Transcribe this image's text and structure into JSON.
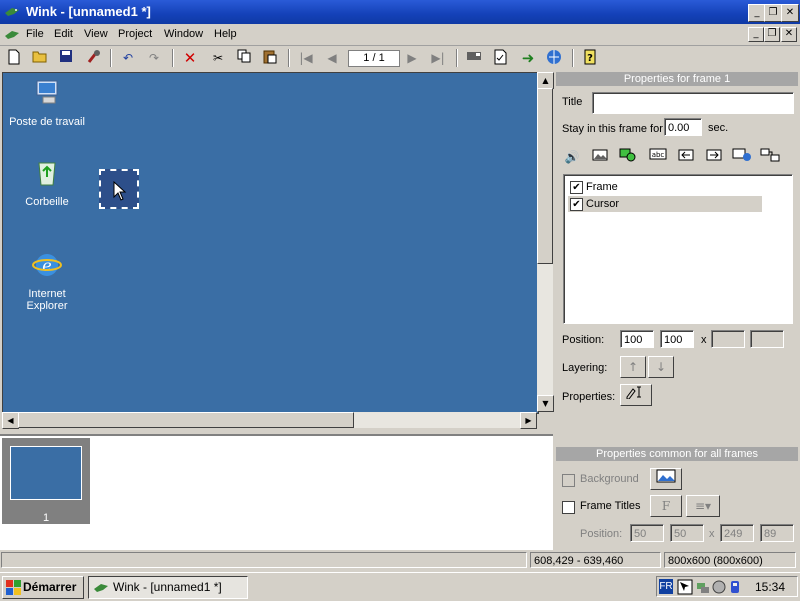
{
  "window": {
    "title": "Wink - [unnamed1 *]",
    "minimize": "_",
    "restore": "❐",
    "close": "✕"
  },
  "menu": [
    "File",
    "Edit",
    "View",
    "Project",
    "Window",
    "Help"
  ],
  "toolbar": {
    "frame_counter": "1 / 1"
  },
  "desktop": {
    "icons": [
      {
        "label": "Poste de travail"
      },
      {
        "label": "Corbeille"
      },
      {
        "label": "Internet\nExplorer"
      }
    ]
  },
  "filmstrip": {
    "frames": [
      {
        "number": "1"
      }
    ]
  },
  "properties_frame": {
    "header": "Properties for frame 1",
    "title_label": "Title",
    "title_value": "",
    "stay_label": "Stay in this frame for",
    "stay_value": "0.00",
    "stay_unit": "sec.",
    "layers": [
      {
        "label": "Frame",
        "checked": true,
        "selected": false
      },
      {
        "label": "Cursor",
        "checked": true,
        "selected": true
      }
    ],
    "position_label": "Position:",
    "position_x": "100",
    "position_y": "100",
    "position_sep": "x",
    "layering_label": "Layering:",
    "properties_label": "Properties:"
  },
  "properties_common": {
    "header": "Properties common for all frames",
    "background_label": "Background",
    "frame_titles_label": "Frame Titles",
    "font_button": "F",
    "position_label": "Position:",
    "pos1": "50",
    "pos2": "50",
    "pos_sep": "x",
    "pos3": "249",
    "pos4": "89"
  },
  "statusbar": {
    "cell1": "",
    "coords": "608,429 - 639,460",
    "size": "800x600 (800x600)"
  },
  "taskbar": {
    "start_label": "Démarrer",
    "task_label": "Wink - [unnamed1 *]",
    "lang": "FR",
    "clock": "15:34"
  },
  "colors": {
    "titlebar": "#0a3bd4",
    "desktop": "#3a6ea5",
    "panel_header": "#a6a6a6"
  }
}
